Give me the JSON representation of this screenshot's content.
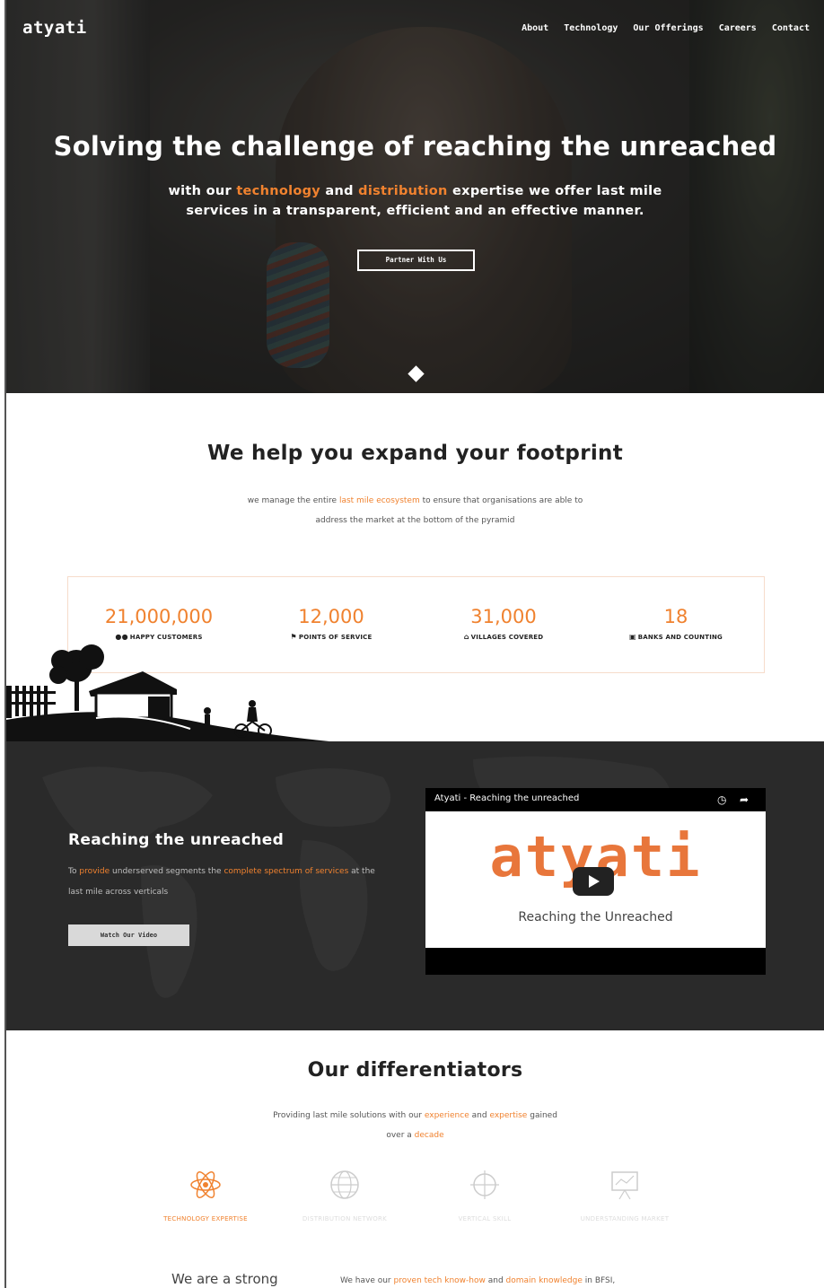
{
  "brand": "atyati",
  "nav": {
    "items": [
      "About",
      "Technology",
      "Our Offerings",
      "Careers",
      "Contact"
    ]
  },
  "hero": {
    "title": "Solving the challenge of reaching the unreached",
    "sub_1": "with our",
    "sub_hl_1": "technology",
    "sub_2": "and",
    "sub_hl_2": "distribution",
    "sub_3": "expertise we offer last mile",
    "sub_line2": "services in a transparent, efficient and an effective manner.",
    "button": "Partner With Us"
  },
  "footprint": {
    "title": "We help you expand your footprint",
    "text_1": "we manage the entire",
    "text_hl": "last mile ecosystem",
    "text_2": "to ensure that organisations are able to",
    "text_line2": "address the market at the bottom of the pyramid",
    "stats": [
      {
        "value": "21,000,000",
        "label": "HAPPY CUSTOMERS",
        "icon": "users-icon"
      },
      {
        "value": "12,000",
        "label": "POINTS OF SERVICE",
        "icon": "flag-icon"
      },
      {
        "value": "31,000",
        "label": "VILLAGES COVERED",
        "icon": "home-icon"
      },
      {
        "value": "18",
        "label": "BANKS AND COUNTING",
        "icon": "bank-icon"
      }
    ]
  },
  "video_section": {
    "title": "Reaching the unreached",
    "text_1": "To",
    "text_hl_1": "provide",
    "text_2": "underserved segments the",
    "text_hl_2": "complete spectrum of services",
    "text_3": "at the",
    "text_line2": "last mile across verticals",
    "button": "Watch Our Video",
    "video_title": "Atyati - Reaching the unreached",
    "video_logo": "atyati",
    "video_tagline": "Reaching the Unreached"
  },
  "differentiators": {
    "title": "Our differentiators",
    "text_1": "Providing last mile solutions with our",
    "text_hl_1": "experience",
    "text_2": "and",
    "text_hl_2": "expertise",
    "text_3": "gained",
    "text_line2_1": "over a",
    "text_hl_3": "decade",
    "items": [
      {
        "label": "TECHNOLOGY EXPERTISE",
        "icon": "atom-icon"
      },
      {
        "label": "DISTRIBUTION NETWORK",
        "icon": "globe-icon"
      },
      {
        "label": "VERTICAL SKILL",
        "icon": "crosshair-icon"
      },
      {
        "label": "UNDERSTANDING MARKET",
        "icon": "presentation-icon"
      }
    ],
    "strong": "We are a strong",
    "strong_text_1": "We have our",
    "strong_hl_1": "proven tech know-how",
    "strong_text_2": "and",
    "strong_hl_2": "domain knowledge",
    "strong_text_3": "in BFSI,"
  }
}
